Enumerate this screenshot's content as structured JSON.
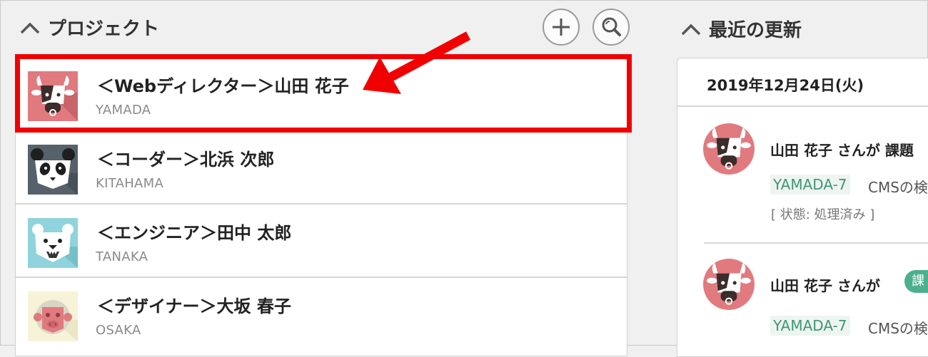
{
  "projects_section": {
    "title": "プロジェクト",
    "add_button_icon": "plus-icon",
    "search_button_icon": "search-icon",
    "items": [
      {
        "name": "＜Webディレクター＞山田 花子",
        "key": "YAMADA",
        "avatar": "cow-avatar"
      },
      {
        "name": "＜コーダー＞北浜 次郎",
        "key": "KITAHAMA",
        "avatar": "panda-avatar"
      },
      {
        "name": "＜エンジニア＞田中 太郎",
        "key": "TANAKA",
        "avatar": "polar-bear-avatar"
      },
      {
        "name": "＜デザイナー＞大坂 春子",
        "key": "OSAKA",
        "avatar": "monkey-avatar"
      }
    ]
  },
  "updates_section": {
    "title": "最近の更新",
    "date": "2019年12月24日(火)",
    "entries": [
      {
        "user": "山田 花子 さんが 課題",
        "issue_key": "YAMADA-7",
        "issue_title": "CMSの検",
        "status": "[ 状態: 処理済み ]",
        "avatar": "cow-avatar"
      },
      {
        "user": "山田 花子 さんが",
        "badge": "課",
        "issue_key": "YAMADA-7",
        "issue_title": "CMSの検",
        "avatar": "cow-avatar"
      }
    ]
  },
  "colors": {
    "highlight": "#f00000",
    "issue_key_text": "#3f9676",
    "badge_green": "#4caf8e",
    "background": "#f0f0f0"
  }
}
